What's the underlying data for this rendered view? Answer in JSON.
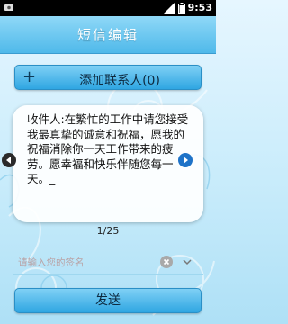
{
  "status_bar": {
    "time": "9:53",
    "icons": [
      "notification-icon",
      "signal-icon",
      "battery-icon"
    ]
  },
  "title_bar": {
    "title": "短信编辑"
  },
  "add_contact": {
    "label": "添加联系人(0)",
    "icon": "plus-icon"
  },
  "message": {
    "text": "收件人:在繁忙的工作中请您接受我最真挚的诚意和祝福，愿我的祝福消除你一天工作带来的疲劳。愿幸福和快乐伴随您每一天。_",
    "counter": "1/25"
  },
  "signature": {
    "value": "",
    "placeholder": "请输入您的签名"
  },
  "send_button": {
    "label": "发送"
  },
  "colors": {
    "accent": "#2fa6e2",
    "title_bar": "#4fb9ea"
  }
}
